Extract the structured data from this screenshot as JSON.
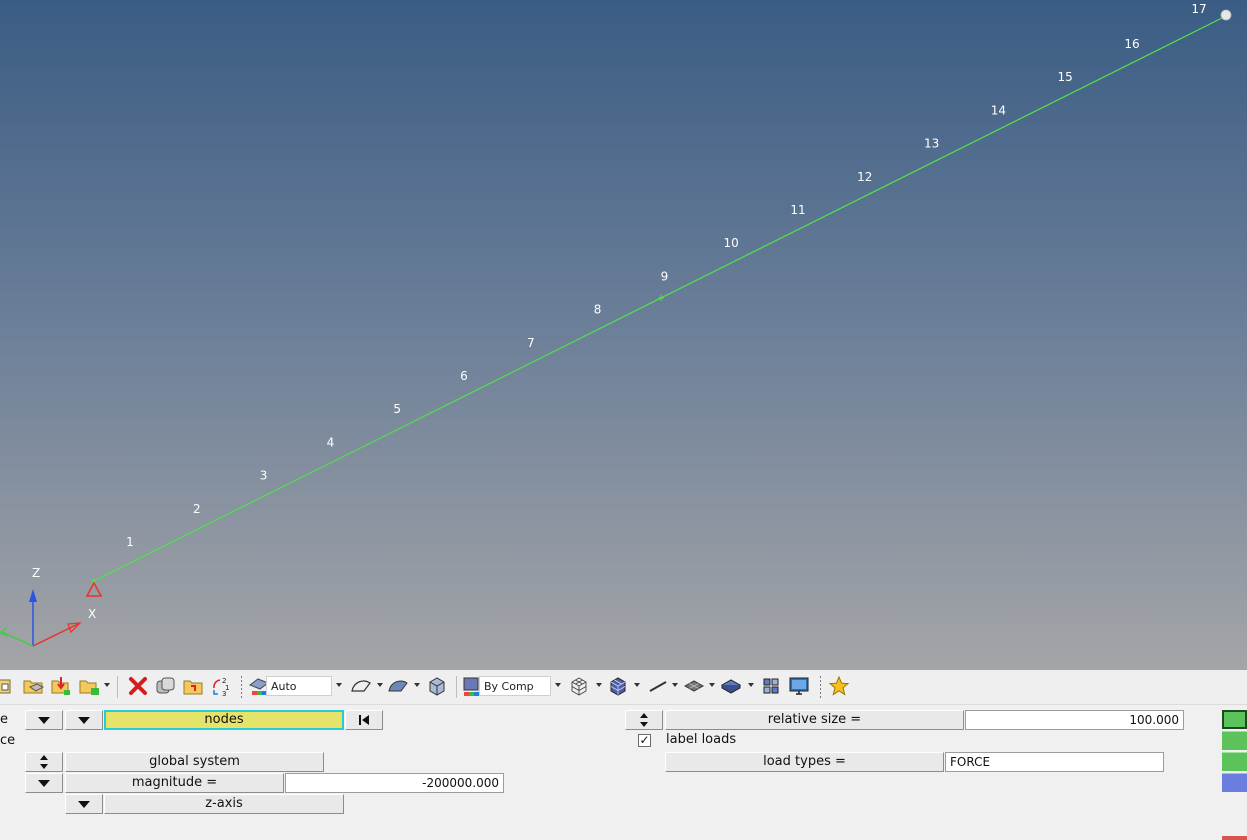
{
  "viewport": {
    "node_labels": [
      "1",
      "2",
      "3",
      "4",
      "5",
      "6",
      "7",
      "8",
      "9",
      "10",
      "11",
      "12",
      "13",
      "14",
      "15",
      "16",
      "17"
    ],
    "triad": {
      "z_label": "Z",
      "x_label": "X"
    }
  },
  "toolbar": {
    "display_mode_select": "Auto",
    "color_mode_select": "By Comp"
  },
  "panel": {
    "left_cut_labels": [
      "e",
      "ce"
    ],
    "entity_selector": "nodes",
    "system_button": "global system",
    "magnitude_label": "magnitude =",
    "magnitude_value": "-200000.000",
    "direction_button": "z-axis",
    "relative_size_label": "relative size =",
    "relative_size_value": "100.000",
    "label_loads_label": "label loads",
    "label_loads_checked": "✓",
    "load_types_label": "load types =",
    "load_types_value": "FORCE"
  },
  "colors": {
    "entity_selector_bg": "#e5e36a",
    "entity_selector_border": "#29c9d6",
    "beam_line": "#4fe24b",
    "constraint": "#e8352b",
    "side_green": "#5cc25c",
    "side_blue": "#6c7de0"
  }
}
